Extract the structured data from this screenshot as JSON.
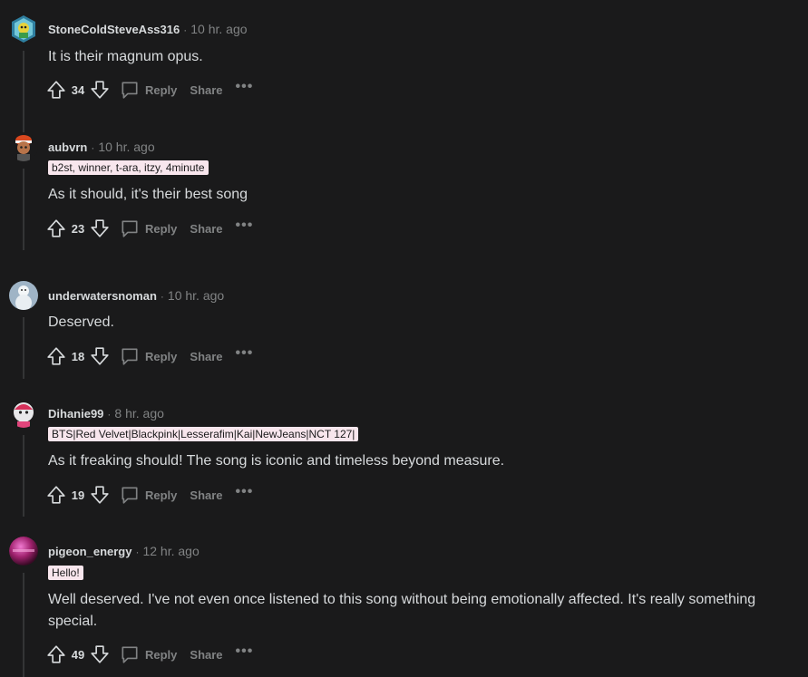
{
  "comments": [
    {
      "username": "StoneColdSteveAss316",
      "timestamp": "10 hr. ago",
      "flair": "",
      "body": "It is their magnum opus.",
      "score": "34",
      "avatar_icon": "snoo-avatar-gecko-icon"
    },
    {
      "username": "aubvrn",
      "timestamp": "10 hr. ago",
      "flair": "b2st, winner, t-ara, itzy, 4minute",
      "body": "As it should, it's their best song",
      "score": "23",
      "avatar_icon": "snoo-avatar-beanie-icon"
    },
    {
      "username": "underwatersnoman",
      "timestamp": "10 hr. ago",
      "flair": "",
      "body": "Deserved.",
      "score": "18",
      "avatar_icon": "snowman-avatar-icon"
    },
    {
      "username": "Dihanie99",
      "timestamp": "8 hr. ago",
      "flair": "BTS|Red Velvet|Blackpink|Lesserafim|Kai|NewJeans|NCT 127|",
      "body": "As it freaking should! The song is iconic and timeless beyond measure.",
      "score": "19",
      "avatar_icon": "snoo-avatar-red-icon"
    },
    {
      "username": "pigeon_energy",
      "timestamp": "12 hr. ago",
      "flair": "Hello!",
      "body": "Well deserved. I've not even once listened to this song without being emotionally affected. It's really something special.",
      "score": "49",
      "avatar_icon": "pink-orb-avatar-icon"
    }
  ],
  "labels": {
    "reply": "Reply",
    "share": "Share",
    "more": "•••",
    "separator": "·"
  },
  "colors": {
    "background": "#1a1a1b",
    "text": "#d7dadc",
    "muted": "#818384",
    "flair_bg": "#f8e6ed",
    "thread_line": "#343536"
  }
}
